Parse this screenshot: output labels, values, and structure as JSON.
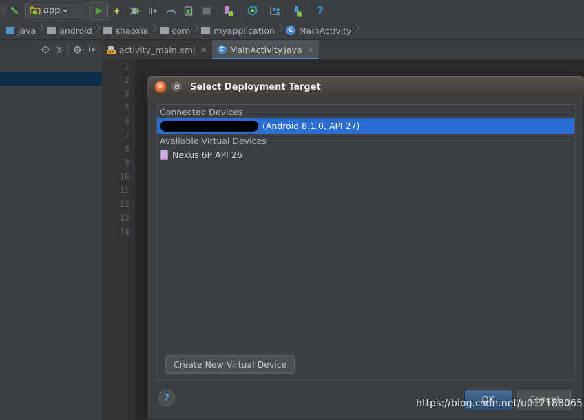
{
  "toolbar": {
    "module_label": "app",
    "items": [
      {
        "name": "build-hammer-icon",
        "title": "Make Project"
      },
      {
        "name": "module-selector",
        "title": "app"
      },
      {
        "name": "run-icon",
        "title": "Run"
      },
      {
        "name": "apply-changes-icon",
        "title": "Apply Changes"
      },
      {
        "name": "debug-icon",
        "title": "Debug"
      },
      {
        "name": "run-to-cursor-icon",
        "title": "Run to Cursor"
      },
      {
        "name": "profiler-icon",
        "title": "Profiler"
      },
      {
        "name": "attach-debugger-icon",
        "title": "Attach Debugger"
      },
      {
        "name": "stop-icon",
        "title": "Stop"
      },
      {
        "name": "sdk-manager-icon",
        "title": "SDK Manager"
      },
      {
        "name": "avd-manager-icon",
        "title": "AVD Manager"
      },
      {
        "name": "sync-gradle-icon",
        "title": "Sync Project with Gradle Files"
      },
      {
        "name": "layout-inspector-icon",
        "title": "Layout Inspector"
      },
      {
        "name": "device-file-explorer-icon",
        "title": "Device File Explorer"
      },
      {
        "name": "help-icon",
        "title": "Help"
      }
    ]
  },
  "breadcrumb": {
    "items": [
      {
        "label": "java",
        "icon": "folder-blue-icon"
      },
      {
        "label": "android",
        "icon": "folder-grey-icon"
      },
      {
        "label": "shaoxia",
        "icon": "folder-grey-icon"
      },
      {
        "label": "com",
        "icon": "folder-grey-icon"
      },
      {
        "label": "myapplication",
        "icon": "folder-grey-icon"
      },
      {
        "label": "MainActivity",
        "icon": "java-class-icon"
      }
    ]
  },
  "project_toolbar": {
    "items": [
      {
        "name": "locate-target-icon"
      },
      {
        "name": "collapse-all-icon"
      },
      {
        "name": "settings-gear-icon"
      },
      {
        "name": "hide-panel-icon"
      }
    ]
  },
  "editor_tabs": [
    {
      "label": "activity_main.xml",
      "icon": "xml-layout-icon",
      "active": false,
      "close": "×"
    },
    {
      "label": "MainActivity.java",
      "icon": "java-class-icon",
      "active": true,
      "close": "×"
    }
  ],
  "editor": {
    "line_numbers": [
      "1",
      "2",
      "3",
      "5",
      "6",
      "7",
      "8",
      "9",
      "10",
      "11",
      "12",
      "13",
      "14"
    ]
  },
  "dialog": {
    "title": "Select Deployment Target",
    "window_buttons": {
      "close": "×",
      "maximize": ""
    },
    "sections": [
      {
        "name": "connected-devices",
        "header": "Connected Devices",
        "rows": [
          {
            "label": "(Android 8.1.0, API 27)",
            "redacted": true,
            "selected": true,
            "icon": "none"
          }
        ]
      },
      {
        "name": "available-virtual-devices",
        "header": "Available Virtual Devices",
        "rows": [
          {
            "label": "Nexus 6P API 26",
            "redacted": false,
            "selected": false,
            "icon": "phone-icon"
          }
        ]
      }
    ],
    "create_button": "Create New Virtual Device",
    "help_button": "?",
    "ok_button": "OK",
    "cancel_button": "Cancel"
  },
  "watermark": "https://blog.csdn.net/u012188065",
  "colors": {
    "ide_background": "#3c3f41",
    "editor_background": "#2b2b2b",
    "gutter_background": "#313335",
    "selection_blue": "#2a6ed4",
    "project_selection": "#0d2c4b",
    "tab_accent": "#4a88c7",
    "titlebar_top": "#56534d",
    "close_button": "#dd6a34",
    "ok_button": "#365c84",
    "help_blue": "#4ba5e0"
  }
}
